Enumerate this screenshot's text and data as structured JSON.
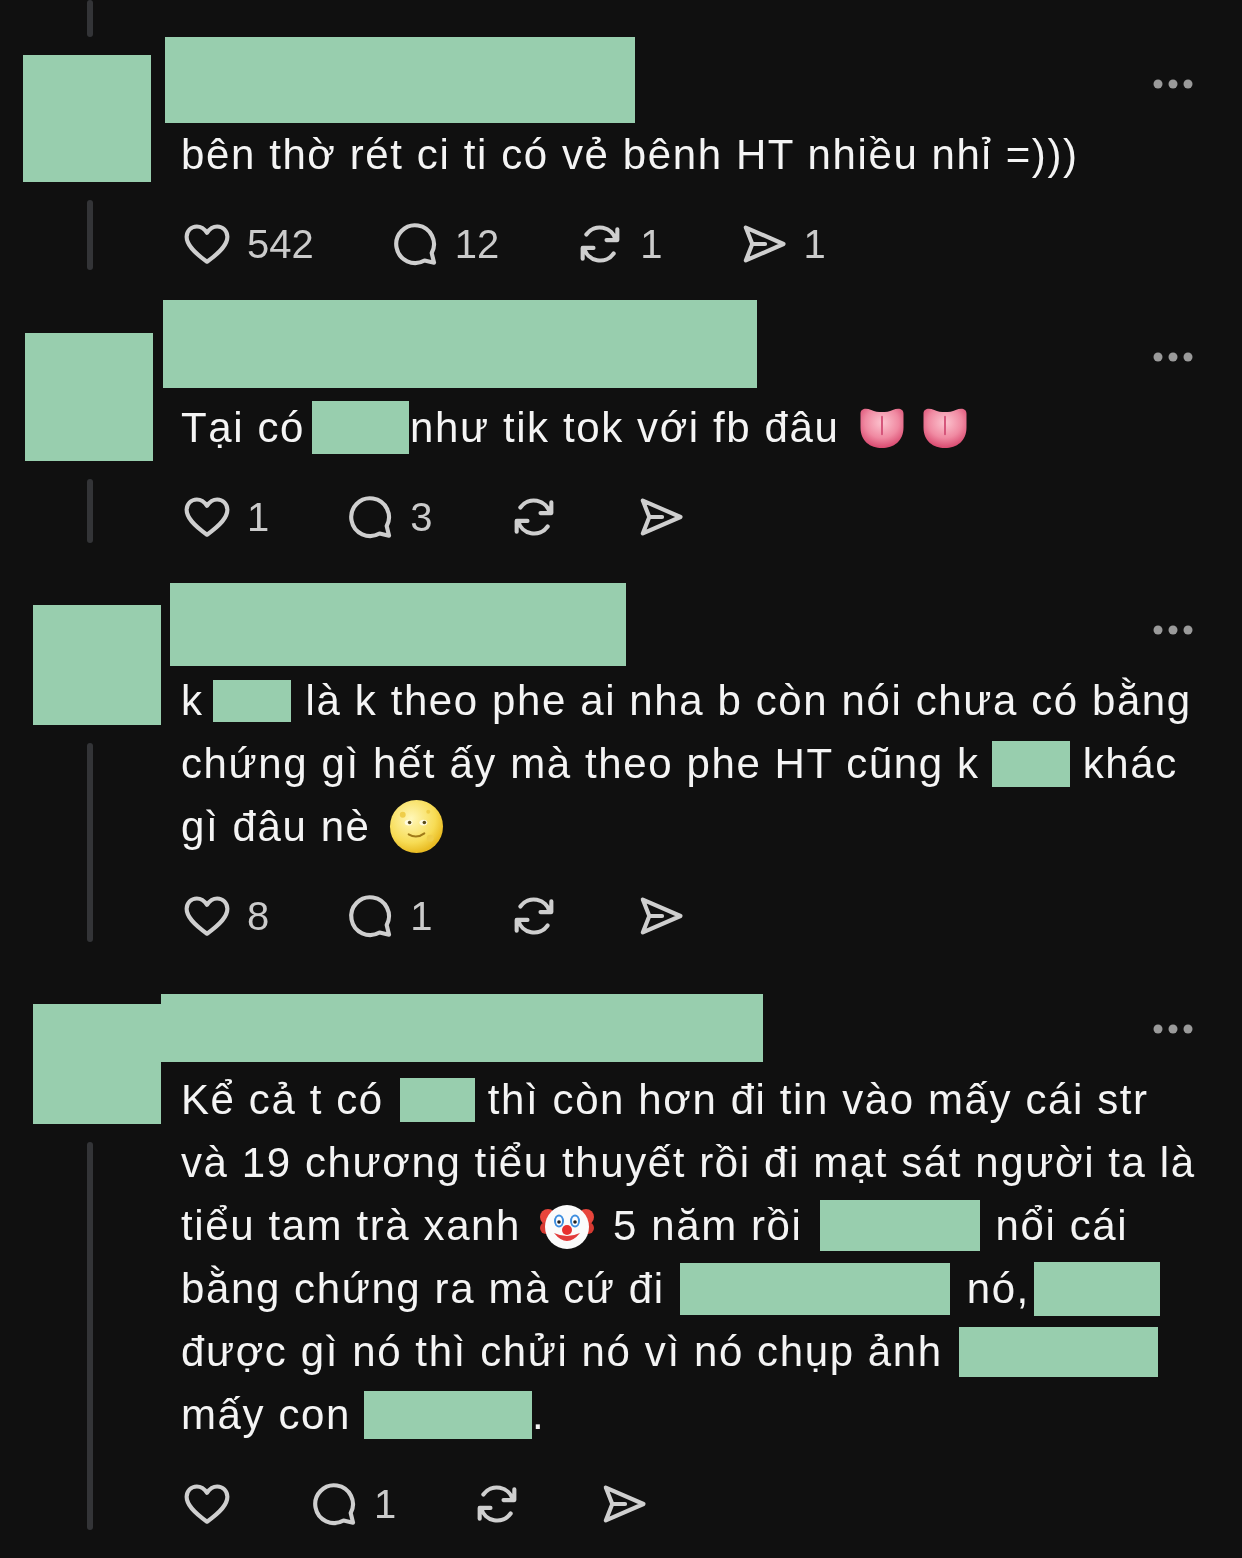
{
  "comments": [
    {
      "avatar": {
        "kind": "redacted"
      },
      "author": {
        "kind": "redacted"
      },
      "lines": [
        [
          {
            "kind": "text",
            "text": "bên thờ rét ci ti có vẻ bênh HT nhiều nhỉ =)))"
          }
        ]
      ],
      "actions": [
        {
          "kind": "like",
          "count": "542"
        },
        {
          "kind": "reply",
          "count": "12"
        },
        {
          "kind": "repost",
          "count": "1"
        },
        {
          "kind": "share",
          "count": "1"
        }
      ]
    },
    {
      "avatar": {
        "kind": "redacted"
      },
      "author": {
        "kind": "redacted"
      },
      "lines": [
        [
          {
            "kind": "text",
            "text": "Tại có"
          },
          {
            "kind": "redacted"
          },
          {
            "kind": "text",
            "text": "như tik tok với fb đâu"
          },
          {
            "kind": "tongue"
          },
          {
            "kind": "tongue"
          }
        ]
      ],
      "actions": [
        {
          "kind": "like",
          "count": "1"
        },
        {
          "kind": "reply",
          "count": "3"
        },
        {
          "kind": "repost"
        },
        {
          "kind": "share"
        }
      ]
    },
    {
      "avatar": {
        "kind": "redacted"
      },
      "author": {
        "kind": "redacted"
      },
      "lines": [
        [
          {
            "kind": "text",
            "text": "k"
          },
          {
            "kind": "redacted"
          },
          {
            "kind": "text",
            "text": "là k theo phe ai nha b còn nói chưa có bằng"
          }
        ],
        [
          {
            "kind": "text",
            "text": "chứng gì hết ấy mà theo phe HT cũng k"
          },
          {
            "kind": "redacted"
          },
          {
            "kind": "text",
            "text": "khác"
          }
        ],
        [
          {
            "kind": "text",
            "text": "gì đâu nè"
          },
          {
            "kind": "moon_face"
          }
        ]
      ],
      "actions": [
        {
          "kind": "like",
          "count": "8"
        },
        {
          "kind": "reply",
          "count": "1"
        },
        {
          "kind": "repost"
        },
        {
          "kind": "share"
        }
      ]
    },
    {
      "avatar": {
        "kind": "redacted"
      },
      "author": {
        "kind": "redacted"
      },
      "lines": [
        [
          {
            "kind": "text",
            "text": "Kể cả t có"
          },
          {
            "kind": "redacted"
          },
          {
            "kind": "text",
            "text": "thì còn hơn đi tin vào mấy cái str"
          }
        ],
        [
          {
            "kind": "text",
            "text": "và 19 chương tiểu thuyết rồi đi mạt sát người ta là"
          }
        ],
        [
          {
            "kind": "text",
            "text": "tiểu tam trà xanh"
          },
          {
            "kind": "clown_face"
          },
          {
            "kind": "text",
            "text": "5 năm rồi"
          },
          {
            "kind": "redacted"
          },
          {
            "kind": "text",
            "text": "nổi cái"
          }
        ],
        [
          {
            "kind": "text",
            "text": "bằng chứng ra mà cứ đi"
          },
          {
            "kind": "redacted"
          },
          {
            "kind": "text",
            "text": "nó,"
          },
          {
            "kind": "redacted"
          }
        ],
        [
          {
            "kind": "text",
            "text": "được gì nó thì chửi nó vì nó chụp ảnh"
          },
          {
            "kind": "redacted"
          }
        ],
        [
          {
            "kind": "text",
            "text": "mấy con"
          },
          {
            "kind": "redacted"
          },
          {
            "kind": "text",
            "text": "."
          }
        ]
      ],
      "actions": [
        {
          "kind": "like"
        },
        {
          "kind": "reply",
          "count": "1"
        },
        {
          "kind": "repost"
        },
        {
          "kind": "share"
        }
      ]
    }
  ]
}
